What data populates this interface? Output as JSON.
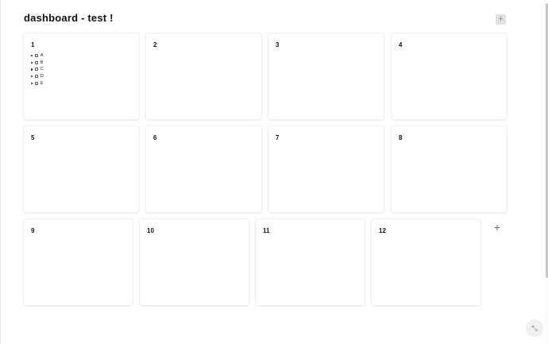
{
  "page": {
    "title": "dashboard - test !"
  },
  "toolbar": {
    "add_icon": "+"
  },
  "cards": [
    {
      "label": "1",
      "items": [
        {
          "label": "A"
        },
        {
          "label": "B"
        },
        {
          "label": "C"
        },
        {
          "label": "D"
        },
        {
          "label": "E"
        }
      ]
    },
    {
      "label": "2"
    },
    {
      "label": "3"
    },
    {
      "label": "4"
    },
    {
      "label": "5"
    },
    {
      "label": "6"
    },
    {
      "label": "7"
    },
    {
      "label": "8"
    },
    {
      "label": "9"
    },
    {
      "label": "10"
    },
    {
      "label": "11"
    },
    {
      "label": "12"
    }
  ],
  "row_add": {
    "icon": "+"
  },
  "fab": {
    "icon": "⤡"
  }
}
